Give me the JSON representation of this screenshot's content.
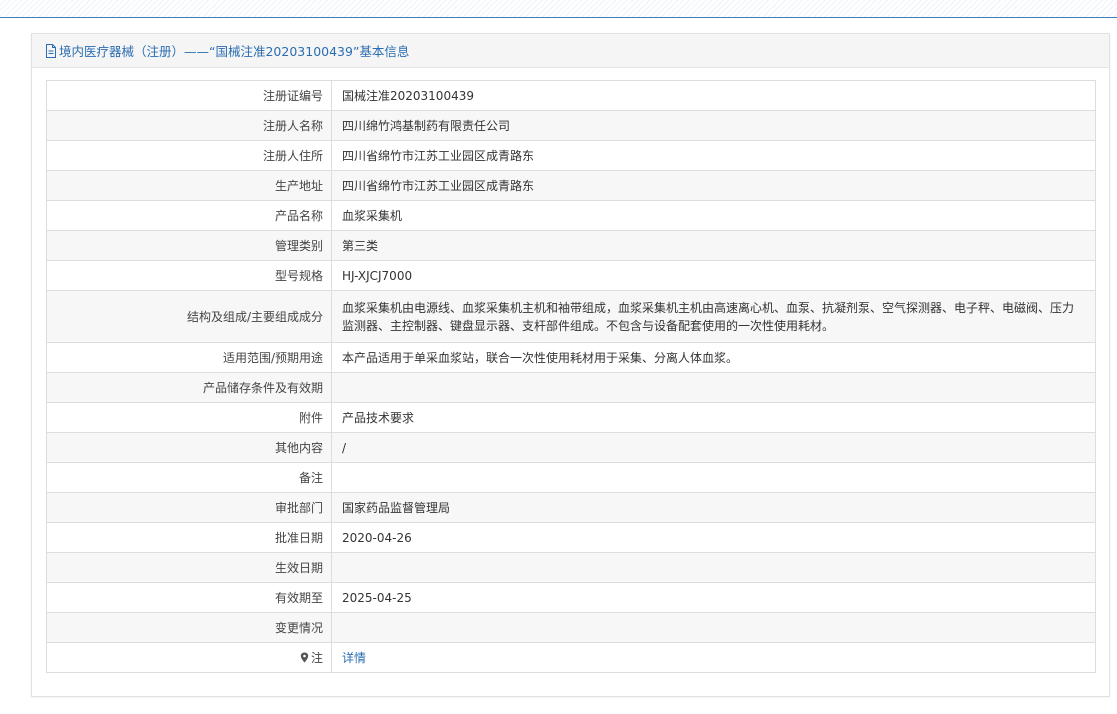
{
  "header": {
    "title": "境内医疗器械（注册）——“国械注准20203100439”基本信息"
  },
  "rows": [
    {
      "label": "注册证编号",
      "value": "国械注准20203100439"
    },
    {
      "label": "注册人名称",
      "value": "四川绵竹鸿基制药有限责任公司"
    },
    {
      "label": "注册人住所",
      "value": "四川省绵竹市江苏工业园区成青路东"
    },
    {
      "label": "生产地址",
      "value": "四川省绵竹市江苏工业园区成青路东"
    },
    {
      "label": "产品名称",
      "value": "血浆采集机"
    },
    {
      "label": "管理类别",
      "value": "第三类"
    },
    {
      "label": "型号规格",
      "value": "HJ-XJCJ7000"
    },
    {
      "label": "结构及组成/主要组成成分",
      "value": "血浆采集机由电源线、血浆采集机主机和袖带组成，血浆采集机主机由高速离心机、血泵、抗凝剂泵、空气探测器、电子秤、电磁阀、压力监测器、主控制器、键盘显示器、支杆部件组成。不包含与设备配套使用的一次性使用耗材。"
    },
    {
      "label": "适用范围/预期用途",
      "value": "本产品适用于单采血浆站，联合一次性使用耗材用于采集、分离人体血浆。"
    },
    {
      "label": "产品储存条件及有效期",
      "value": ""
    },
    {
      "label": "附件",
      "value": "产品技术要求"
    },
    {
      "label": "其他内容",
      "value": "/"
    },
    {
      "label": "备注",
      "value": ""
    },
    {
      "label": "审批部门",
      "value": "国家药品监督管理局"
    },
    {
      "label": "批准日期",
      "value": "2020-04-26"
    },
    {
      "label": "生效日期",
      "value": ""
    },
    {
      "label": "有效期至",
      "value": "2025-04-25"
    },
    {
      "label": "变更情况",
      "value": ""
    },
    {
      "label": "注",
      "value": "详情"
    }
  ],
  "icons": {
    "header": "document-icon",
    "note": "map-pin-icon"
  },
  "colors": {
    "link": "#2a6db2",
    "header_bg": "#f5f5f5",
    "alt_row_bg": "#f7f7f7",
    "border": "#dddddd"
  }
}
